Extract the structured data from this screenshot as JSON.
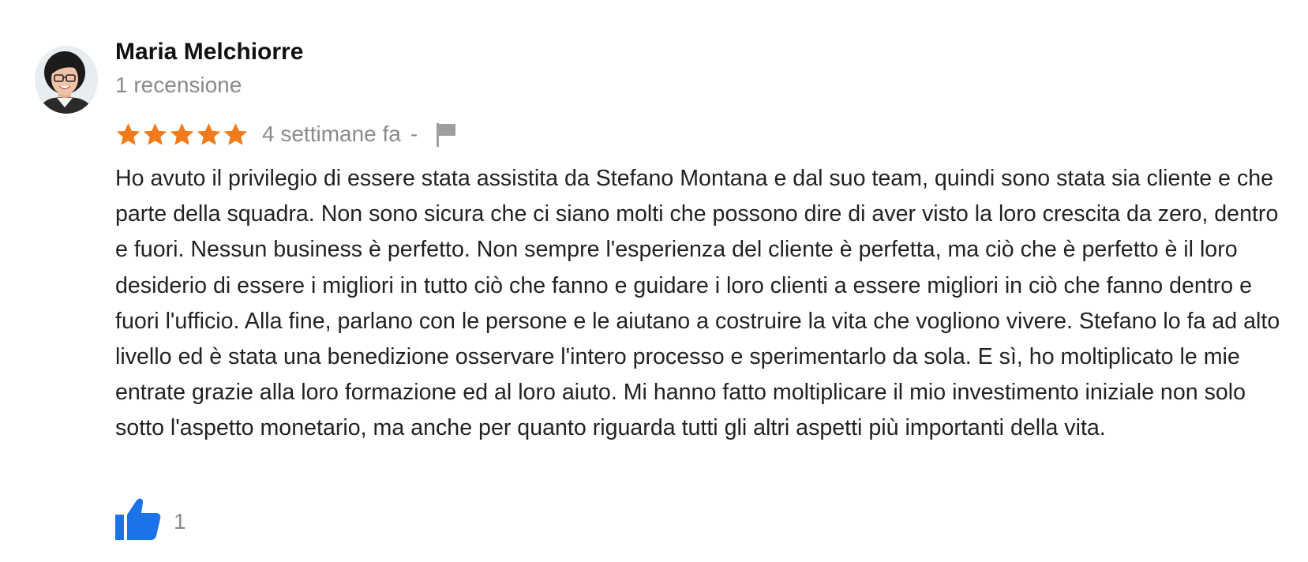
{
  "review": {
    "author": {
      "name": "Maria Melchiorre",
      "review_count": "1 recensione",
      "avatar_icon": "profile-photo"
    },
    "rating": {
      "stars": 5,
      "max": 5,
      "star_color": "#f07b1d"
    },
    "time_ago": "4 settimane fa",
    "separator": "-",
    "flag_icon": "flag-icon",
    "text": "Ho avuto il privilegio di essere stata assistita da Stefano Montana e dal suo team, quindi sono stata sia cliente e che parte della squadra. Non sono sicura che ci siano molti che possono dire di aver visto la loro crescita da zero, dentro e fuori. Nessun business è perfetto. Non sempre l'esperienza del cliente è perfetta, ma ciò che è perfetto è il loro desiderio di essere i migliori in tutto ciò che fanno e guidare i loro clienti a essere migliori in ciò che fanno dentro e fuori l'ufficio. Alla fine, parlano con le persone e le aiutano a costruire la vita che vogliono vivere. Stefano lo fa ad alto livello ed è stata una benedizione osservare l'intero processo e sperimentarlo da sola. E sì, ho moltiplicato le mie entrate grazie alla loro formazione ed al loro aiuto. Mi hanno fatto moltiplicare il mio investimento iniziale non solo sotto l'aspetto monetario, ma anche per quanto riguarda tutti gli altri aspetti più importanti della vita.",
    "likes": {
      "icon": "thumbs-up-icon",
      "count": "1",
      "color": "#1a73e8"
    }
  }
}
